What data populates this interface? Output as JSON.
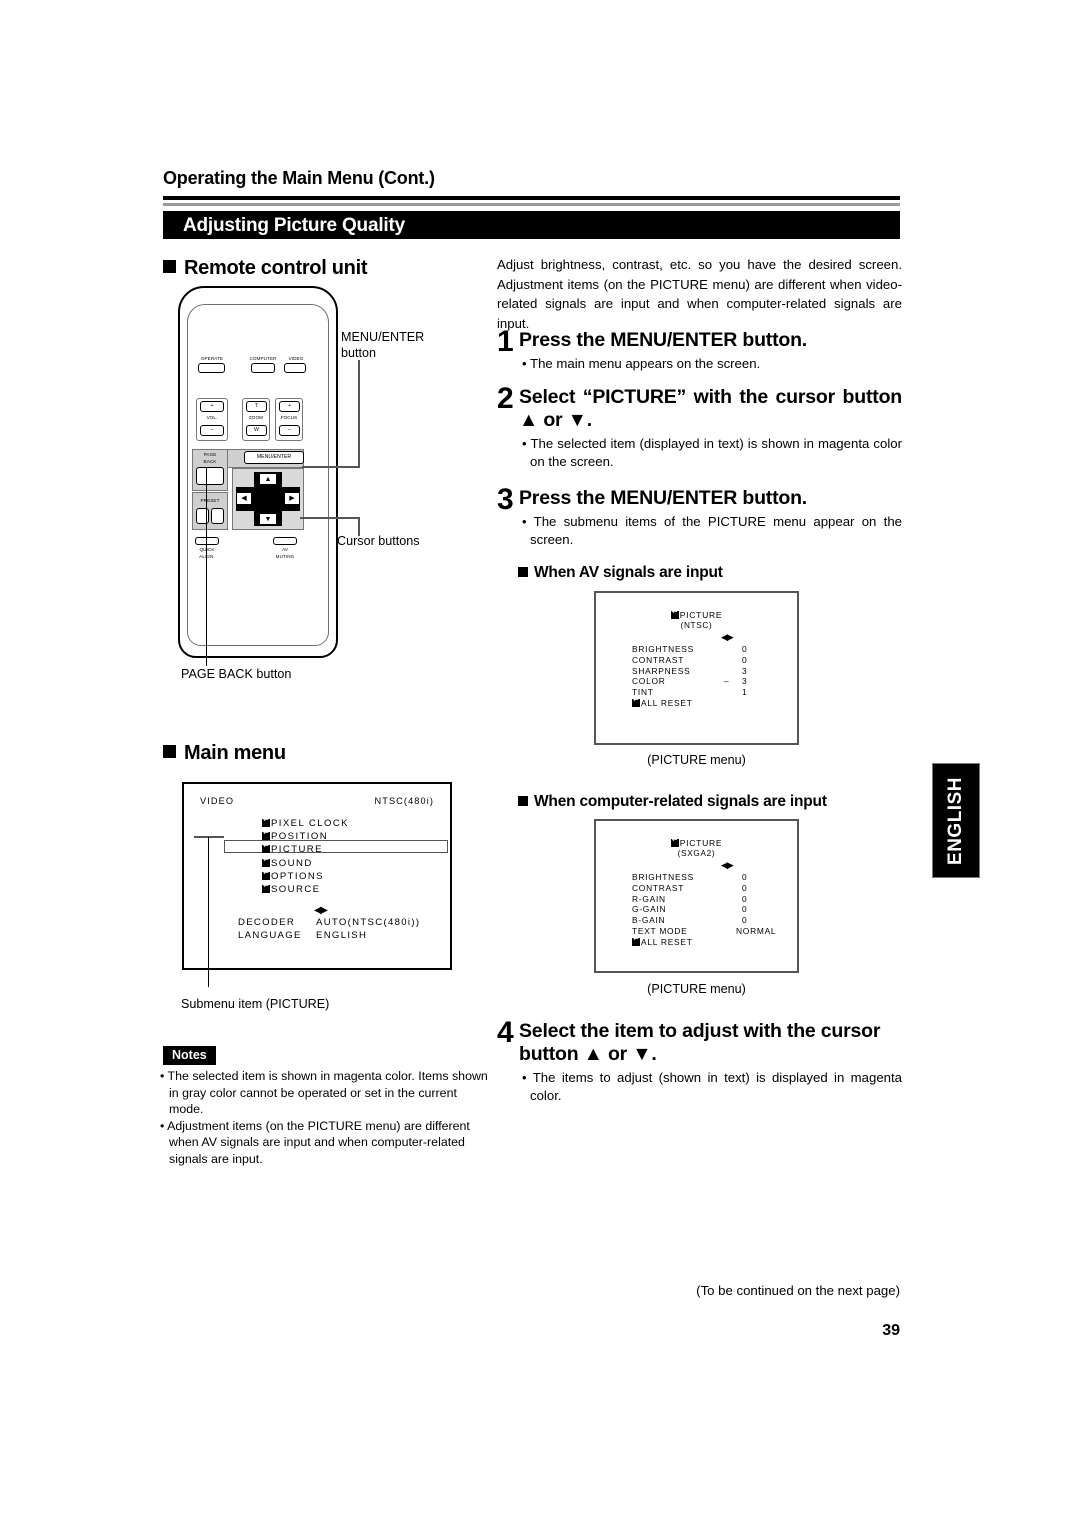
{
  "header": {
    "running_head": "Operating the Main Menu (Cont.)",
    "section_title": "Adjusting Picture Quality"
  },
  "left_column": {
    "remote_heading": "Remote control unit",
    "main_menu_heading": "Main menu",
    "callouts": {
      "menu_enter": "MENU/ENTER\nbutton",
      "menu_enter_line1": "MENU/ENTER",
      "menu_enter_line2": "button",
      "cursor_buttons": "Cursor buttons",
      "page_back": "PAGE BACK button",
      "submenu_item": "Submenu item (PICTURE)"
    },
    "remote_buttons": {
      "operate": "OPERATE",
      "computer": "COMPUTER",
      "video": "VIDEO",
      "vol": "VOL.",
      "vol_plus": "+",
      "vol_minus": "–",
      "zoom": "ZOOM",
      "zoom_t": "T",
      "zoom_w": "W",
      "focus": "FOCUS",
      "focus_plus": "+",
      "focus_minus": "–",
      "menu_enter": "MENU/ENTER",
      "page": "PAGE",
      "back": "BACK",
      "preset": "PRESET",
      "quick_align_l1": "QUICK",
      "quick_align_l2": "ALIGN.",
      "av_muting_l1": "AV",
      "av_muting_l2": "MUTING",
      "cursor_up": "▲",
      "cursor_down": "▼",
      "cursor_left": "◀",
      "cursor_right": "▶"
    }
  },
  "main_menu_osd": {
    "source": "VIDEO",
    "signal": "NTSC(480i)",
    "items": [
      "PIXEL CLOCK",
      "POSITION",
      "PICTURE",
      "SOUND",
      "OPTIONS",
      "SOURCE"
    ],
    "highlighted_item": "PICTURE",
    "arrows": "◀▶",
    "settings": [
      {
        "key": "DECODER",
        "value": "AUTO(NTSC(480i))"
      },
      {
        "key": "LANGUAGE",
        "value": "ENGLISH"
      }
    ]
  },
  "right_column": {
    "intro": "Adjust brightness, contrast, etc. so you have the desired screen. Adjustment items (on the PICTURE menu) are different when video-related signals are input and when computer-related signals are input.",
    "steps": [
      {
        "num": "1",
        "title": "Press the MENU/ENTER button.",
        "bullets": [
          "• The main menu appears on the screen."
        ]
      },
      {
        "num": "2",
        "title": "Select “PICTURE” with the cursor button ▲ or ▼.",
        "bullets": [
          "• The selected item (displayed in text) is shown in magenta color on the screen."
        ]
      },
      {
        "num": "3",
        "title": "Press the MENU/ENTER button.",
        "bullets": [
          "• The submenu items of the PICTURE menu appear on the screen."
        ]
      },
      {
        "num": "4",
        "title": "Select the item to adjust with the cursor button ▲ or ▼.",
        "bullets": [
          "• The items to adjust (shown in text) is displayed in magenta color."
        ]
      }
    ],
    "av_heading": "When AV signals are input",
    "computer_heading": "When computer-related signals are input",
    "menu_caption": "(PICTURE menu)"
  },
  "av_picture_menu": {
    "title": "PICTURE",
    "subtitle": "(NTSC)",
    "arrows": "◀▶",
    "rows": [
      {
        "label": "BRIGHTNESS",
        "sign": "",
        "value": "0"
      },
      {
        "label": "CONTRAST",
        "sign": "",
        "value": "0"
      },
      {
        "label": "SHARPNESS",
        "sign": "",
        "value": "3"
      },
      {
        "label": "COLOR",
        "sign": "–",
        "value": "3"
      },
      {
        "label": "TINT",
        "sign": "",
        "value": "1"
      }
    ],
    "reset_label": "ALL RESET"
  },
  "computer_picture_menu": {
    "title": "PICTURE",
    "subtitle": "(SXGA2)",
    "arrows": "◀▶",
    "rows": [
      {
        "label": "BRIGHTNESS",
        "sign": "",
        "value": "0"
      },
      {
        "label": "CONTRAST",
        "sign": "",
        "value": "0"
      },
      {
        "label": "R-GAIN",
        "sign": "",
        "value": "0"
      },
      {
        "label": "G-GAIN",
        "sign": "",
        "value": "0"
      },
      {
        "label": "B-GAIN",
        "sign": "",
        "value": "0"
      },
      {
        "label": "TEXT MODE",
        "sign": "",
        "value": "NORMAL"
      }
    ],
    "reset_label": "ALL RESET"
  },
  "notes": {
    "tag": "Notes",
    "items": [
      "• The selected item is shown in magenta color. Items shown in gray color cannot be operated or set in the current mode.",
      "• Adjustment items (on the PICTURE menu) are different when AV signals are input and when computer-related signals are input."
    ]
  },
  "side_tab": {
    "label": "ENGLISH"
  },
  "footer": {
    "continued": "(To be continued on the next page)",
    "page_number": "39"
  }
}
